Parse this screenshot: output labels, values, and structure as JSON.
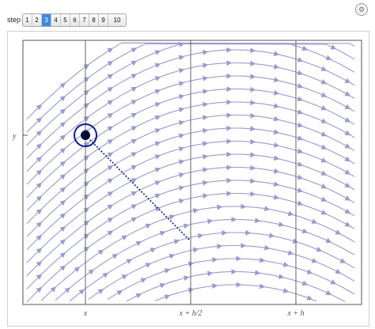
{
  "controls": {
    "step_label": "step",
    "steps": [
      "1",
      "2",
      "3",
      "4",
      "5",
      "6",
      "7",
      "8",
      "9",
      "10"
    ],
    "selected_step": "3"
  },
  "plot": {
    "y_label": "y",
    "x_tick_labels": [
      "x",
      "x + h/2",
      "x + h"
    ]
  },
  "colors": {
    "stream": "#9b9bd0",
    "marker": "#0b1a8c",
    "selected_step": "#3d8ce0"
  },
  "icons": {
    "options": "gear-icon"
  }
}
